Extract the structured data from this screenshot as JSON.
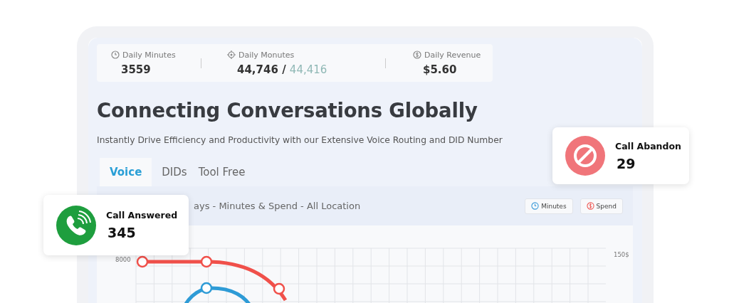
{
  "stats": [
    {
      "kind": "clock",
      "label": "Daily Minutes",
      "value": "3559"
    },
    {
      "kind": "target",
      "label": "Daily Monutes",
      "value": "44,746",
      "separator": "/",
      "secondary": "44,416"
    },
    {
      "kind": "dollar",
      "label": "Daily Revenue",
      "value": "$5.60"
    }
  ],
  "heading": "Connecting Conversations Globally",
  "subtitle": "Instantly Drive Efficiency and Productivity with our Extensive Voice Routing and DID Number",
  "tabs": [
    {
      "label": "Voice",
      "selected": true
    },
    {
      "label": "DIDs",
      "selected": false
    },
    {
      "label": "Tool Free",
      "selected": false
    }
  ],
  "chart": {
    "title": "ays - Minutes & Spend - All Location",
    "buttons": [
      {
        "kind": "clock",
        "label": "Minutes"
      },
      {
        "kind": "dollar",
        "label": "Spend"
      }
    ],
    "left_tick": "8000",
    "right_tick": "150$"
  },
  "cards": [
    {
      "kind": "phone",
      "title": "Call Answered",
      "value": "345"
    },
    {
      "kind": "block",
      "title": "Call Abandon",
      "value": "29"
    }
  ]
}
